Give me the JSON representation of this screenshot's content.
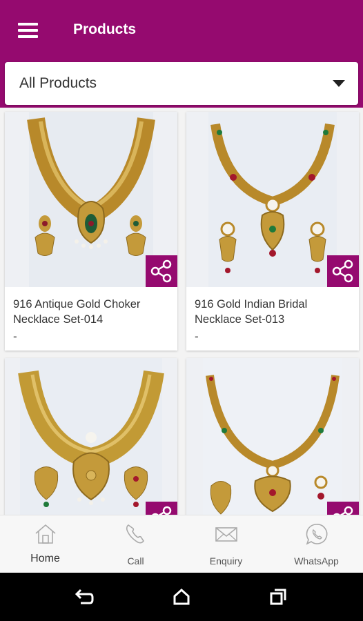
{
  "header": {
    "title": "Products",
    "menu_icon": "hamburger-menu-icon"
  },
  "filter": {
    "selected": "All Products",
    "icon": "dropdown-caret-icon"
  },
  "products": [
    {
      "name": "916 Antique Gold Choker Necklace Set-014",
      "price": "-"
    },
    {
      "name": "916 Gold Indian Bridal Necklace Set-013",
      "price": "-"
    },
    {
      "name": "",
      "price": ""
    },
    {
      "name": "",
      "price": ""
    }
  ],
  "bottom_nav": [
    {
      "label": "Home",
      "icon": "home-icon",
      "active": true
    },
    {
      "label": "Call",
      "icon": "phone-icon",
      "active": false
    },
    {
      "label": "Enquiry",
      "icon": "mail-icon",
      "active": false
    },
    {
      "label": "WhatsApp",
      "icon": "whatsapp-icon",
      "active": false
    }
  ],
  "system_nav": [
    "back-icon",
    "home-circle-icon",
    "recents-icon"
  ],
  "colors": {
    "brand": "#950a6f",
    "gold": "#c9a33a"
  }
}
